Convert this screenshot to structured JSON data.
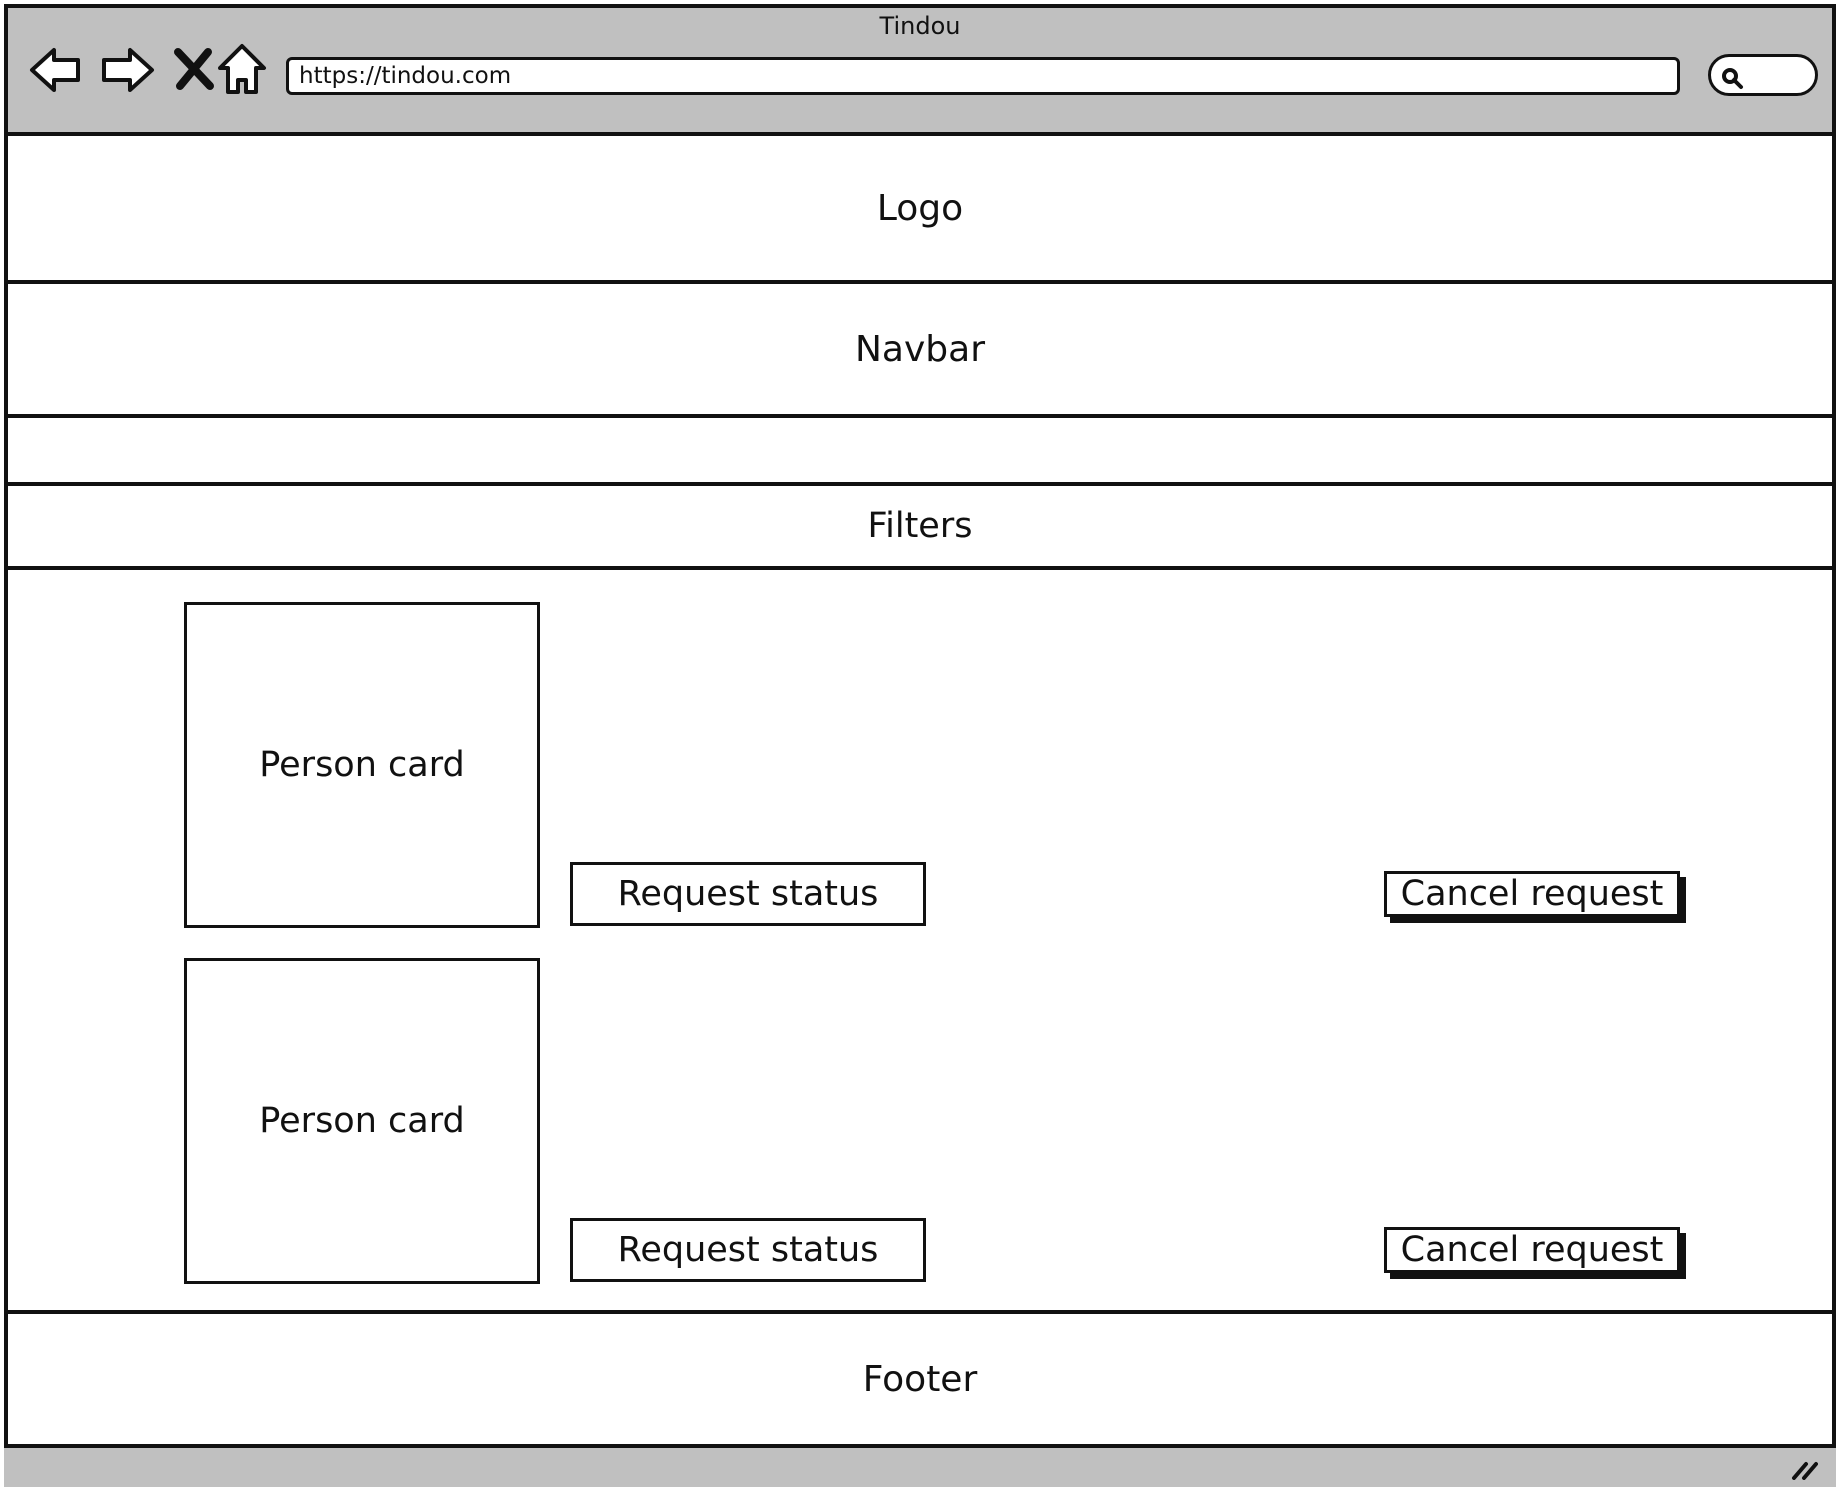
{
  "window": {
    "title": "Tindou",
    "url": "https://tindou.com"
  },
  "toolbar": {
    "icons": [
      "back-arrow-icon",
      "forward-arrow-icon",
      "close-icon",
      "home-icon",
      "search-icon",
      "resize-grip-icon"
    ]
  },
  "header": {
    "logo_label": "Logo"
  },
  "navbar": {
    "label": "Navbar"
  },
  "filters": {
    "label": "Filters"
  },
  "requests": [
    {
      "card_label": "Person card",
      "status_label": "Request status",
      "cancel_label": "Cancel request"
    },
    {
      "card_label": "Person card",
      "status_label": "Request status",
      "cancel_label": "Cancel request"
    }
  ],
  "footer": {
    "label": "Footer"
  },
  "colors": {
    "chrome": "#c0c0c0",
    "stroke": "#111111",
    "background": "#ffffff"
  }
}
